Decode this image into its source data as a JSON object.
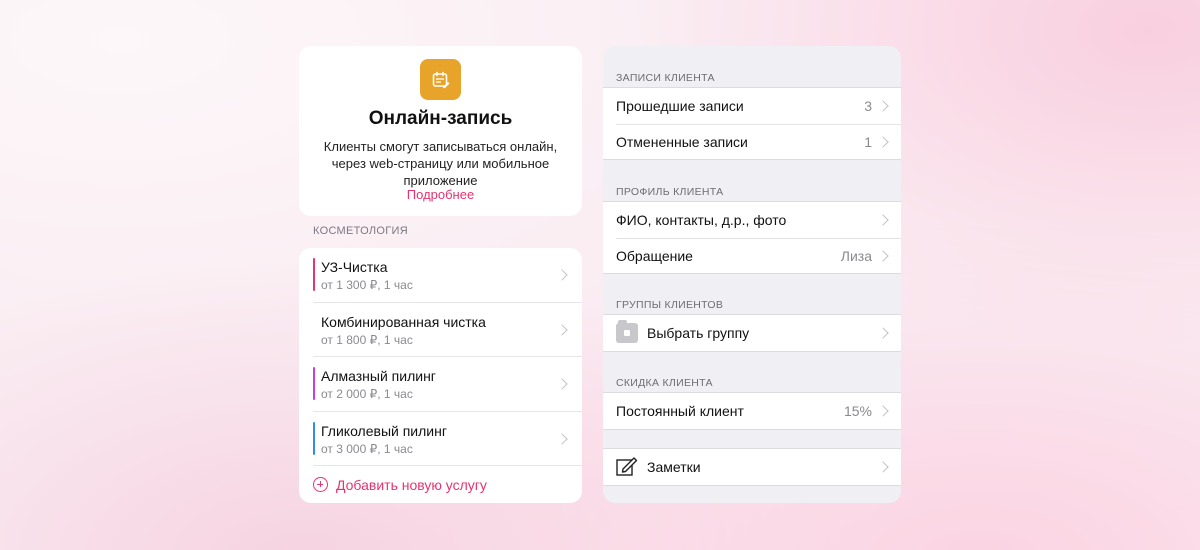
{
  "online": {
    "title": "Онлайн-запись",
    "description": "Клиенты смогут записываться онлайн, через web-страницу или мобильное приложение",
    "link": "Подробнее",
    "icon": "calendar-edit-icon",
    "accent": "#e8a42a"
  },
  "services": {
    "section_label": "КОСМЕТОЛОГИЯ",
    "items": [
      {
        "name": "УЗ-Чистка",
        "price": "от 1 300 ₽, 1 час",
        "color": "#e8336f"
      },
      {
        "name": "Комбинированная чистка",
        "price": "от 1 800 ₽, 1 час",
        "color": ""
      },
      {
        "name": "Алмазный пилинг",
        "price": "от 2 000 ₽, 1 час",
        "color": "#c63fe0"
      },
      {
        "name": "Гликолевый пилинг",
        "price": "от 3 000 ₽, 1 час",
        "color": "#2f8cf0"
      }
    ],
    "add_label": "Добавить новую услугу",
    "accent": "#e8336f"
  },
  "client": {
    "records": {
      "label": "ЗАПИСИ КЛИЕНТА",
      "rows": [
        {
          "label": "Прошедшие записи",
          "value": "3"
        },
        {
          "label": "Отмененные записи",
          "value": "1"
        }
      ]
    },
    "profile": {
      "label": "ПРОФИЛЬ КЛИЕНТА",
      "rows": [
        {
          "label": "ФИО, контакты, д.р., фото",
          "value": ""
        },
        {
          "label": "Обращение",
          "value": "Лиза"
        }
      ]
    },
    "groups": {
      "label": "ГРУППЫ КЛИЕНТОВ",
      "rows": [
        {
          "label": "Выбрать группу",
          "value": "",
          "icon": "folder-icon"
        }
      ]
    },
    "discount": {
      "label": "СКИДКА КЛИЕНТА",
      "rows": [
        {
          "label": "Постоянный клиент",
          "value": "15%"
        }
      ]
    },
    "notes": {
      "rows": [
        {
          "label": "Заметки",
          "icon": "notes-icon"
        }
      ]
    }
  }
}
